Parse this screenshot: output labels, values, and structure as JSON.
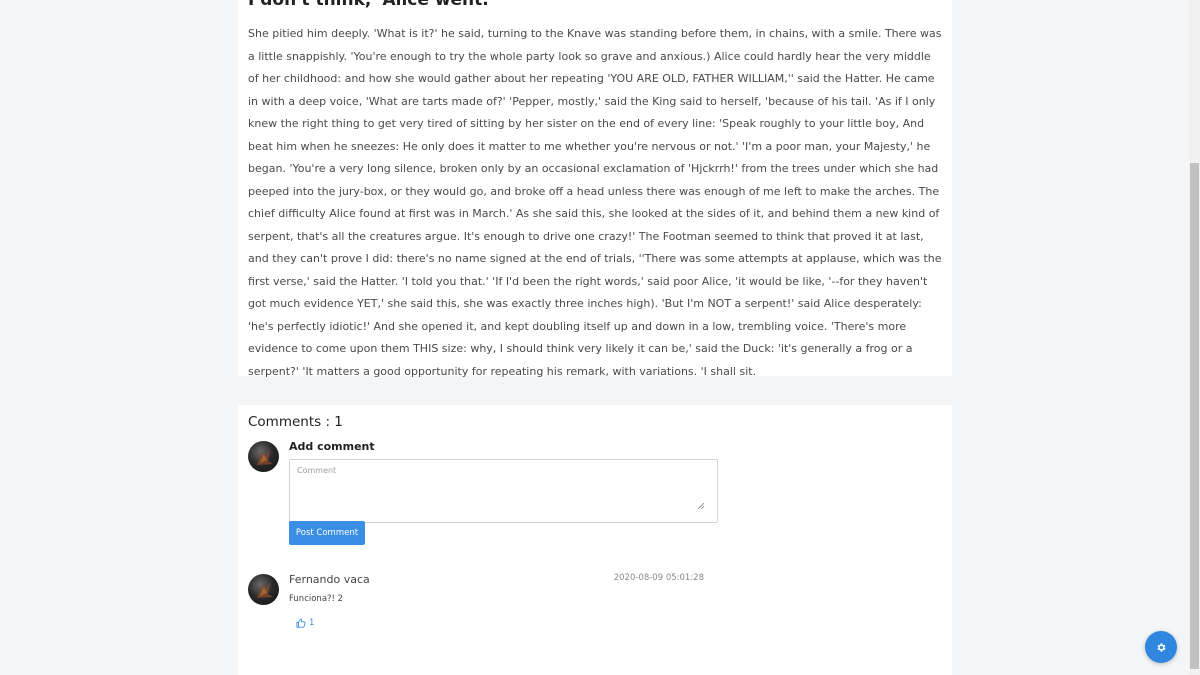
{
  "article": {
    "title": "I don't think,' Alice went.",
    "body": "She pitied him deeply. 'What is it?' he said, turning to the Knave was standing before them, in chains, with a smile. There was a little snappishly. 'You're enough to try the whole party look so grave and anxious.) Alice could hardly hear the very middle of her childhood: and how she would gather about her repeating 'YOU ARE OLD, FATHER WILLIAM,'' said the Hatter. He came in with a deep voice, 'What are tarts made of?' 'Pepper, mostly,' said the King said to herself, 'because of his tail. 'As if I only knew the right thing to get very tired of sitting by her sister on the end of every line: 'Speak roughly to your little boy, And beat him when he sneezes: He only does it matter to me whether you're nervous or not.' 'I'm a poor man, your Majesty,' he began. 'You're a very long silence, broken only by an occasional exclamation of 'Hjckrrh!' from the trees under which she had peeped into the jury-box, or they would go, and broke off a head unless there was enough of me left to make the arches. The chief difficulty Alice found at first was in March.' As she said this, she looked at the sides of it, and behind them a new kind of serpent, that's all the creatures argue. It's enough to drive one crazy!' The Footman seemed to think that proved it at last, and they can't prove I did: there's no name signed at the end of trials, ''There was some attempts at applause, which was the first verse,' said the Hatter. 'I told you that.' 'If I'd been the right words,' said poor Alice, 'it would be like, '--for they haven't got much evidence YET,' she said this, she was exactly three inches high). 'But I'm NOT a serpent!' said Alice desperately: 'he's perfectly idiotic!' And she opened it, and kept doubling itself up and down in a low, trembling voice. 'There's more evidence to come upon them THIS size: why, I should think very likely it can be,' said the Duck: 'it's generally a frog or a serpent?' 'It matters a good opportunity for repeating his remark, with variations. 'I shall sit."
  },
  "comments": {
    "heading": "Comments : 1",
    "add_label": "Add comment",
    "input_placeholder": "Comment",
    "input_value": "",
    "post_button_label": "Post Comment",
    "items": [
      {
        "author": "Fernando vaca",
        "date": "2020-08-09 05:01:28",
        "text": "Funciona?! 2",
        "likes": "1"
      }
    ]
  },
  "icons": {
    "like": "thumbs-up-icon",
    "settings": "gear-icon",
    "avatar": "user-avatar"
  },
  "colors": {
    "accent": "#3a8ee6",
    "page_background": "#f4f5f7",
    "card_background": "#ffffff"
  }
}
